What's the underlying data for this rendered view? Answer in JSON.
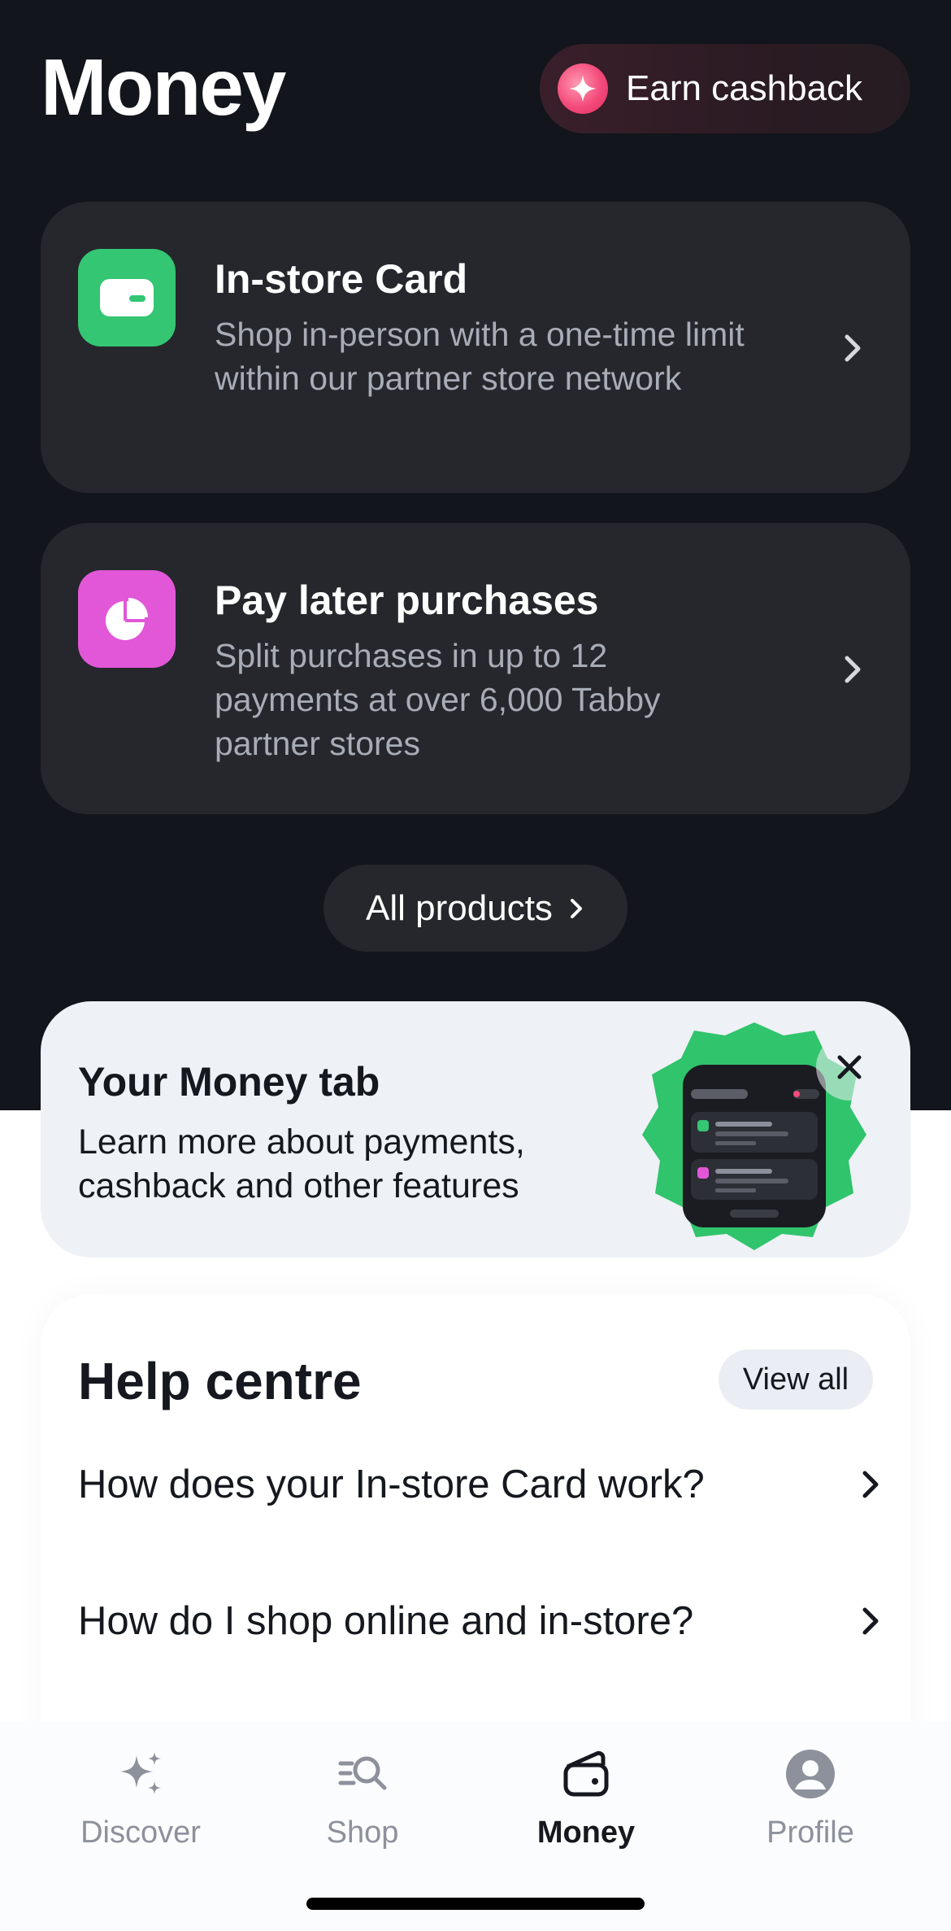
{
  "header": {
    "title": "Money",
    "earn_cashback_label": "Earn cashback"
  },
  "products": [
    {
      "title": "In-store Card",
      "description": "Shop in-person with a one-time limit within our partner store network",
      "icon": "card-icon",
      "icon_color": "#34c673"
    },
    {
      "title": "Pay later purchases",
      "description": "Split purchases in up to 12 payments at over 6,000 Tabby partner stores",
      "icon": "pie-chart-icon",
      "icon_color": "#e257d8"
    }
  ],
  "all_products_label": "All products",
  "promo": {
    "title": "Your Money tab",
    "description": "Learn more about payments, cashback and other features",
    "accent": "#30c46c"
  },
  "help": {
    "title": "Help centre",
    "view_all_label": "View all",
    "items": [
      {
        "label": "How does your In-store Card work?"
      },
      {
        "label": "How do I shop online and in-store?"
      }
    ]
  },
  "tabs": [
    {
      "label": "Discover",
      "icon": "sparkles-icon",
      "active": false
    },
    {
      "label": "Shop",
      "icon": "search-list-icon",
      "active": false
    },
    {
      "label": "Money",
      "icon": "wallet-icon",
      "active": true
    },
    {
      "label": "Profile",
      "icon": "profile-icon",
      "active": false
    }
  ],
  "colors": {
    "dark_bg": "#12151b",
    "card_bg": "#25272c",
    "accent_pink": "#f34b7a"
  }
}
